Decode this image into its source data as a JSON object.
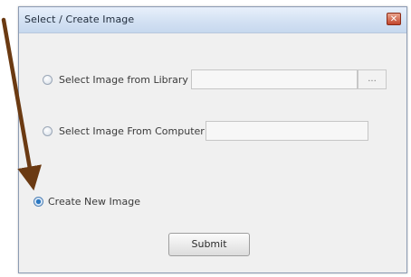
{
  "window": {
    "title": "Select / Create Image",
    "close_glyph": "✕"
  },
  "options": {
    "library": {
      "label": "Select Image from Library",
      "selected": false,
      "field_value": "",
      "browse_label": "..."
    },
    "computer": {
      "label": "Select Image From Computer",
      "selected": false,
      "field_value": ""
    },
    "create_new": {
      "label": "Create New Image",
      "selected": true
    }
  },
  "actions": {
    "submit_label": "Submit"
  },
  "annotation": {
    "arrow_color": "#6b3a12",
    "points_to": "create-new-image-radio"
  },
  "colors": {
    "accent_radio": "#2b78c2",
    "titlebar": "#d3e1f3"
  }
}
